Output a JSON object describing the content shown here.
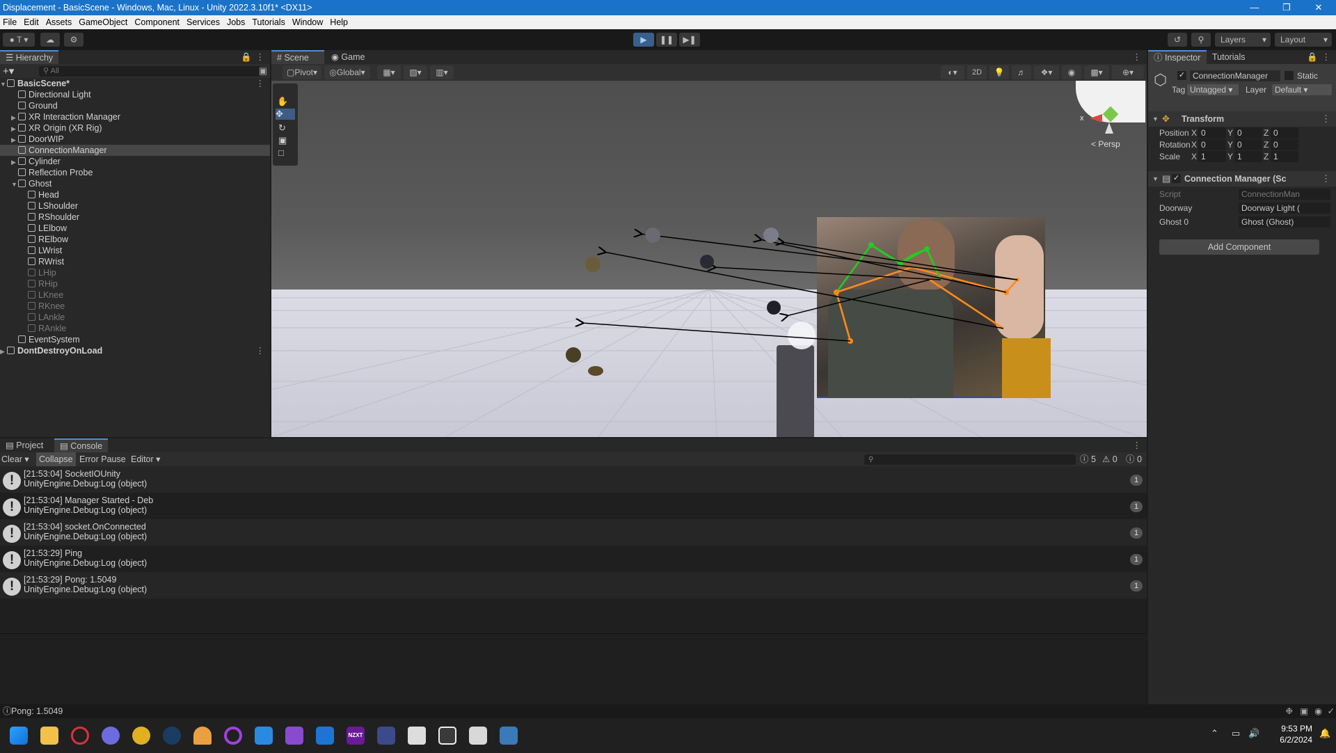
{
  "window": {
    "title": "Displacement - BasicScene - Windows, Mac, Linux - Unity 2022.3.10f1* <DX11>"
  },
  "menu": [
    "File",
    "Edit",
    "Assets",
    "GameObject",
    "Component",
    "Services",
    "Jobs",
    "Tutorials",
    "Window",
    "Help"
  ],
  "toolbar": {
    "account": "T",
    "layers": "Layers",
    "layout": "Layout"
  },
  "hierarchy": {
    "tab": "Hierarchy",
    "search_placeholder": "All",
    "rows": [
      {
        "label": "BasicScene*",
        "level": 0,
        "kind": "scene"
      },
      {
        "label": "Directional Light",
        "level": 1
      },
      {
        "label": "Ground",
        "level": 1
      },
      {
        "label": "XR Interaction Manager",
        "level": 1,
        "expand": true
      },
      {
        "label": "XR Origin (XR Rig)",
        "level": 1,
        "expand": true
      },
      {
        "label": "DoorWIP",
        "level": 1,
        "expand": true
      },
      {
        "label": "ConnectionManager",
        "level": 1,
        "selected": true
      },
      {
        "label": "Cylinder",
        "level": 1,
        "expand": true
      },
      {
        "label": "Reflection Probe",
        "level": 1
      },
      {
        "label": "Ghost",
        "level": 1,
        "open": true
      },
      {
        "label": "Head",
        "level": 2
      },
      {
        "label": "LShoulder",
        "level": 2
      },
      {
        "label": "RShoulder",
        "level": 2
      },
      {
        "label": "LElbow",
        "level": 2
      },
      {
        "label": "RElbow",
        "level": 2
      },
      {
        "label": "LWrist",
        "level": 2
      },
      {
        "label": "RWrist",
        "level": 2
      },
      {
        "label": "LHip",
        "level": 2,
        "dim": true
      },
      {
        "label": "RHip",
        "level": 2,
        "dim": true
      },
      {
        "label": "LKnee",
        "level": 2,
        "dim": true
      },
      {
        "label": "RKnee",
        "level": 2,
        "dim": true
      },
      {
        "label": "LAnkle",
        "level": 2,
        "dim": true
      },
      {
        "label": "RAnkle",
        "level": 2,
        "dim": true
      },
      {
        "label": "EventSystem",
        "level": 1
      },
      {
        "label": "DontDestroyOnLoad",
        "level": 0,
        "kind": "scene",
        "expand": true
      }
    ]
  },
  "scene": {
    "tabs": [
      "Scene",
      "Game"
    ],
    "pivot": "Pivot",
    "global": "Global",
    "mode_2d": "2D",
    "persp": "Persp",
    "gizmo_x": "x"
  },
  "inspector": {
    "tabs": [
      "Inspector",
      "Tutorials"
    ],
    "object_name": "ConnectionManager",
    "static_label": "Static",
    "tag_label": "Tag",
    "tag_value": "Untagged",
    "layer_label": "Layer",
    "layer_value": "Default",
    "transform": {
      "title": "Transform",
      "rows": [
        {
          "label": "Position",
          "x": "0",
          "y": "0",
          "z": "0"
        },
        {
          "label": "Rotation",
          "x": "0",
          "y": "0",
          "z": "0"
        },
        {
          "label": "Scale",
          "x": "1",
          "y": "1",
          "z": "1"
        }
      ],
      "axis": [
        "X",
        "Y",
        "Z"
      ]
    },
    "component": {
      "title": "Connection Manager (Sc",
      "fields": [
        {
          "label": "Script",
          "value": "ConnectionMan"
        },
        {
          "label": "Doorway",
          "value": "Doorway Light ("
        },
        {
          "label": "Ghost 0",
          "value": "Ghost (Ghost)"
        }
      ]
    },
    "add_component": "Add Component"
  },
  "console": {
    "tabs": [
      "Project",
      "Console"
    ],
    "buttons": {
      "clear": "Clear",
      "collapse": "Collapse",
      "error_pause": "Error Pause",
      "editor": "Editor"
    },
    "counts": {
      "log": "5",
      "warn": "0",
      "error": "0"
    },
    "entries": [
      {
        "line1": "[21:53:04] SocketIOUnity",
        "line2": "UnityEngine.Debug:Log (object)",
        "count": "1"
      },
      {
        "line1": "[21:53:04] Manager Started - Deb",
        "line2": "UnityEngine.Debug:Log (object)",
        "count": "1"
      },
      {
        "line1": "[21:53:04] socket.OnConnected",
        "line2": "UnityEngine.Debug:Log (object)",
        "count": "1"
      },
      {
        "line1": "[21:53:29] Ping",
        "line2": "UnityEngine.Debug:Log (object)",
        "count": "1"
      },
      {
        "line1": "[21:53:29] Pong: 1.5049",
        "line2": "UnityEngine.Debug:Log (object)",
        "count": "1"
      }
    ]
  },
  "status": {
    "message": "Pong: 1.5049"
  },
  "taskbar": {
    "time": "9:53 PM",
    "date": "6/2/2024",
    "nzxt": "NZXT"
  }
}
